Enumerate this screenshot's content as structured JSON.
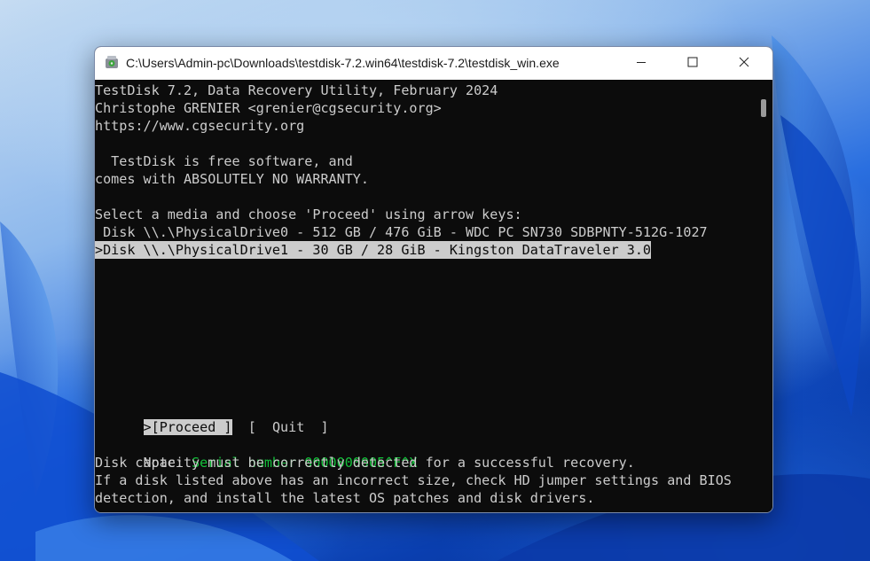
{
  "window": {
    "title": "C:\\Users\\Admin-pc\\Downloads\\testdisk-7.2.win64\\testdisk-7.2\\testdisk_win.exe",
    "app_icon": "testdisk-app-icon",
    "controls": {
      "minimize_icon": "minimize-icon",
      "maximize_icon": "maximize-icon",
      "close_icon": "close-icon"
    }
  },
  "console": {
    "header": [
      "TestDisk 7.2, Data Recovery Utility, February 2024",
      "Christophe GRENIER <grenier@cgsecurity.org>",
      "https://www.cgsecurity.org"
    ],
    "license": [
      "  TestDisk is free software, and",
      "comes with ABSOLUTELY NO WARRANTY."
    ],
    "prompt": "Select a media and choose 'Proceed' using arrow keys:",
    "disks": [
      " Disk \\\\.\\PhysicalDrive0 - 512 GB / 476 GiB - WDC PC SN730 SDBPNTY-512G-1027",
      ">Disk \\\\.\\PhysicalDrive1 - 30 GB / 28 GiB - Kingston DataTraveler 3.0"
    ],
    "menu": {
      "proceed": ">[Proceed ]",
      "quit": "[  Quit  ]"
    },
    "note_label": "Note: ",
    "serial": "Serial number 0000000005^F^X",
    "notes": [
      "Disk capacity must be correctly detected for a successful recovery.",
      "If a disk listed above has an incorrect size, check HD jumper settings and BIOS",
      "detection, and install the latest OS patches and disk drivers."
    ]
  },
  "colors": {
    "console_bg": "#0c0c0c",
    "console_text": "#cccccc",
    "highlight_bg": "#cccccc",
    "serial_green": "#13c13a"
  }
}
